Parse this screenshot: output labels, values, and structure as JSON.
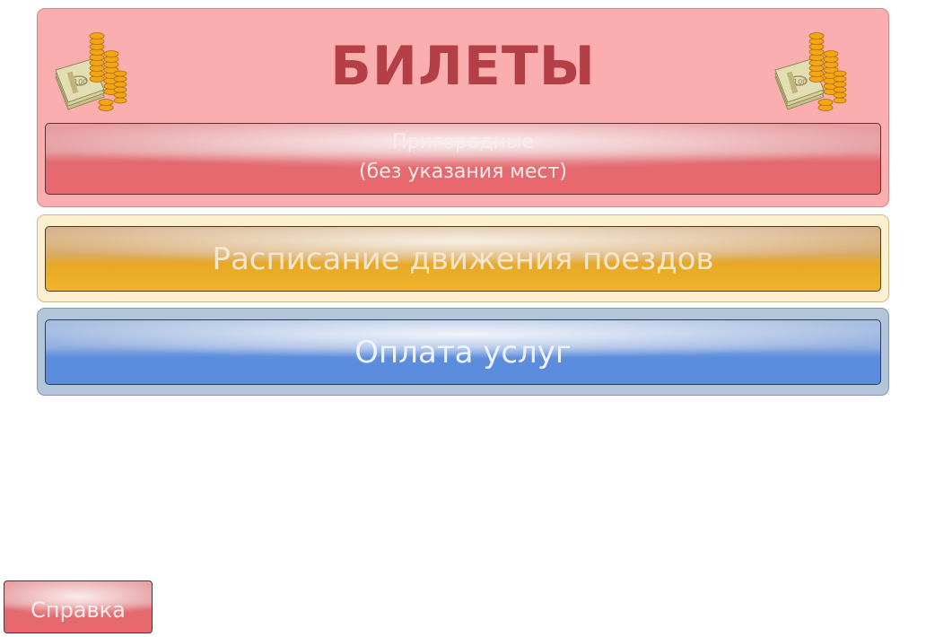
{
  "tickets": {
    "title": "БИЛЕТЫ",
    "suburban_button": {
      "line1": "Пригородные",
      "line2": "(без указания мест)"
    }
  },
  "schedule": {
    "label": "Расписание движения поездов"
  },
  "payment": {
    "label": "Оплата услуг"
  },
  "help": {
    "label": "Справка"
  },
  "icons": {
    "left_decoration": "money-icon",
    "right_decoration": "money-icon"
  },
  "colors": {
    "tickets_panel": "#fbaeb0",
    "title": "#b43f46",
    "schedule_button": "#f0b42a",
    "payment_button": "#5a8bdf",
    "help_button": "#e9686e"
  }
}
